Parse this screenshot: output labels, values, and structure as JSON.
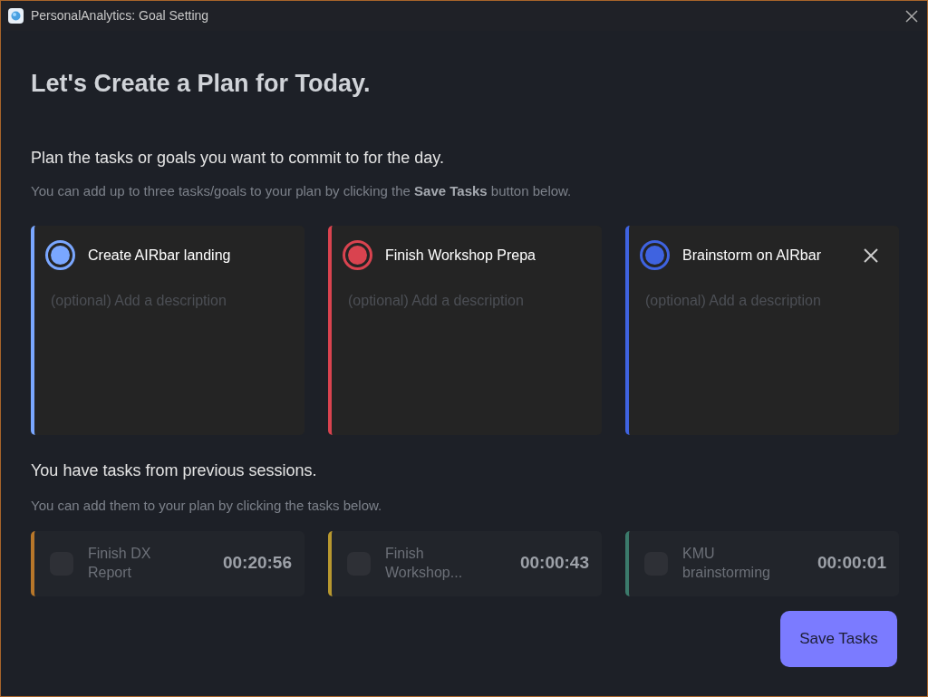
{
  "window": {
    "title": "PersonalAnalytics: Goal Setting"
  },
  "heading": "Let's Create a Plan for Today.",
  "intro": "Plan the tasks or goals you want to commit to for the day.",
  "intro_hint": "You can add up to three tasks/goals to your plan by clicking the **Save Tasks** button below.",
  "plan_tasks": [
    {
      "title": "Create AIRbar landing",
      "placeholder": "(optional) Add a description",
      "color": "#7aa7ff",
      "removable": false
    },
    {
      "title": "Finish Workshop Prepa",
      "placeholder": "(optional) Add a description",
      "color": "#d9434f",
      "removable": false
    },
    {
      "title": "Brainstorm on AIRbar",
      "placeholder": "(optional) Add a description",
      "color": "#3f63e0",
      "removable": true
    }
  ],
  "previous_heading": "You have tasks from previous sessions.",
  "previous_hint": "You can add them to your plan by clicking the tasks below.",
  "previous_tasks": [
    {
      "title": "Finish DX Report",
      "time": "00:20:56",
      "color": "#b8772a",
      "checked": false
    },
    {
      "title": "Finish Workshop...",
      "time": "00:00:43",
      "color": "#b8982f",
      "checked": false
    },
    {
      "title": "KMU brainstorming",
      "time": "00:00:01",
      "color": "#3b7a6b",
      "checked": false
    }
  ],
  "save_button": "Save Tasks"
}
